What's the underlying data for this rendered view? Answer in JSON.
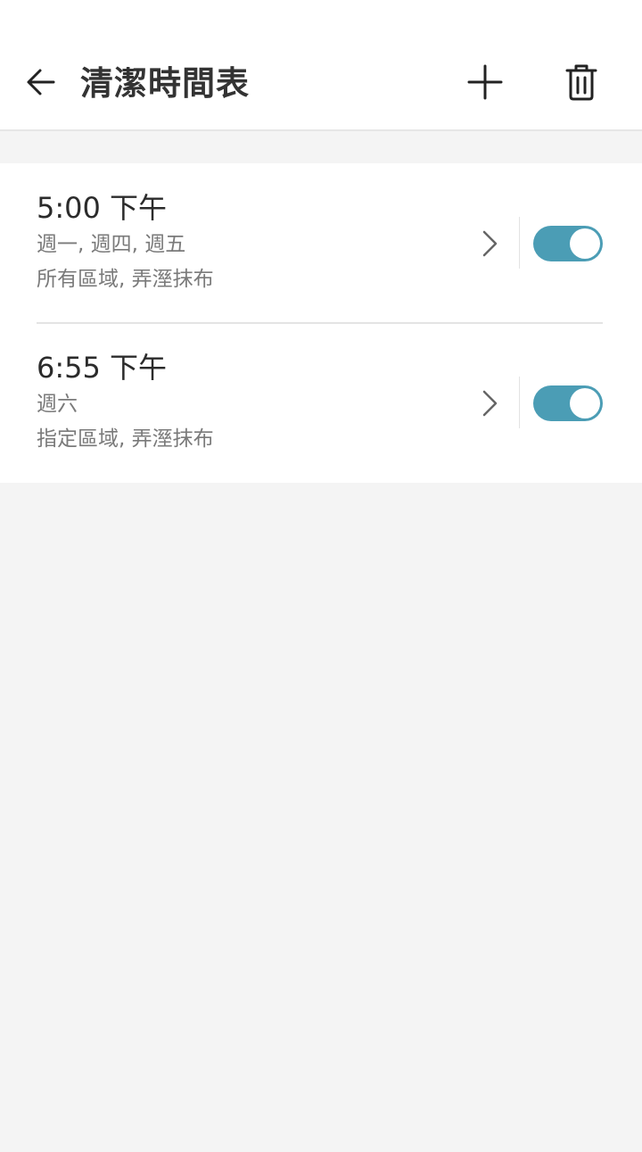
{
  "header": {
    "title": "清潔時間表",
    "back_icon": "arrow-left-icon",
    "add_icon": "plus-icon",
    "delete_icon": "trash-icon"
  },
  "schedules": [
    {
      "time": "5:00 下午",
      "days": "週一, 週四, 週五",
      "mode": "所有區域, 弄溼抹布",
      "enabled": true
    },
    {
      "time": "6:55 下午",
      "days": "週六",
      "mode": "指定區域, 弄溼抹布",
      "enabled": true
    }
  ],
  "colors": {
    "accent": "#4b9db5",
    "background": "#f4f4f4",
    "card": "#ffffff",
    "text_primary": "#2b2b2b",
    "text_secondary": "#7a7a7a"
  }
}
